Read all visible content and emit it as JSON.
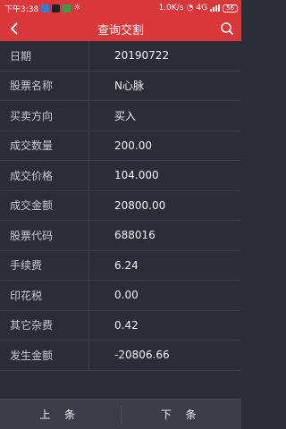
{
  "status_bar": {
    "time": "下午3:38",
    "network_speed": "1.0K/s",
    "network_type": "4G",
    "battery": "56"
  },
  "header": {
    "title": "查询交割"
  },
  "rows": [
    {
      "label": "日期",
      "value": "20190722"
    },
    {
      "label": "股票名称",
      "value": "N心脉"
    },
    {
      "label": "买卖方向",
      "value": "买入"
    },
    {
      "label": "成交数量",
      "value": "200.00"
    },
    {
      "label": "成交价格",
      "value": "104.000"
    },
    {
      "label": "成交金额",
      "value": "20800.00"
    },
    {
      "label": "股票代码",
      "value": "688016"
    },
    {
      "label": "手续费",
      "value": "6.24"
    },
    {
      "label": "印花税",
      "value": "0.00"
    },
    {
      "label": "其它杂费",
      "value": "0.42"
    },
    {
      "label": "发生金额",
      "value": "-20806.66"
    }
  ],
  "footer": {
    "prev_label": "上 条",
    "next_label": "下 条"
  },
  "colors": {
    "accent": "#d9373a",
    "background": "#2b2d35"
  }
}
